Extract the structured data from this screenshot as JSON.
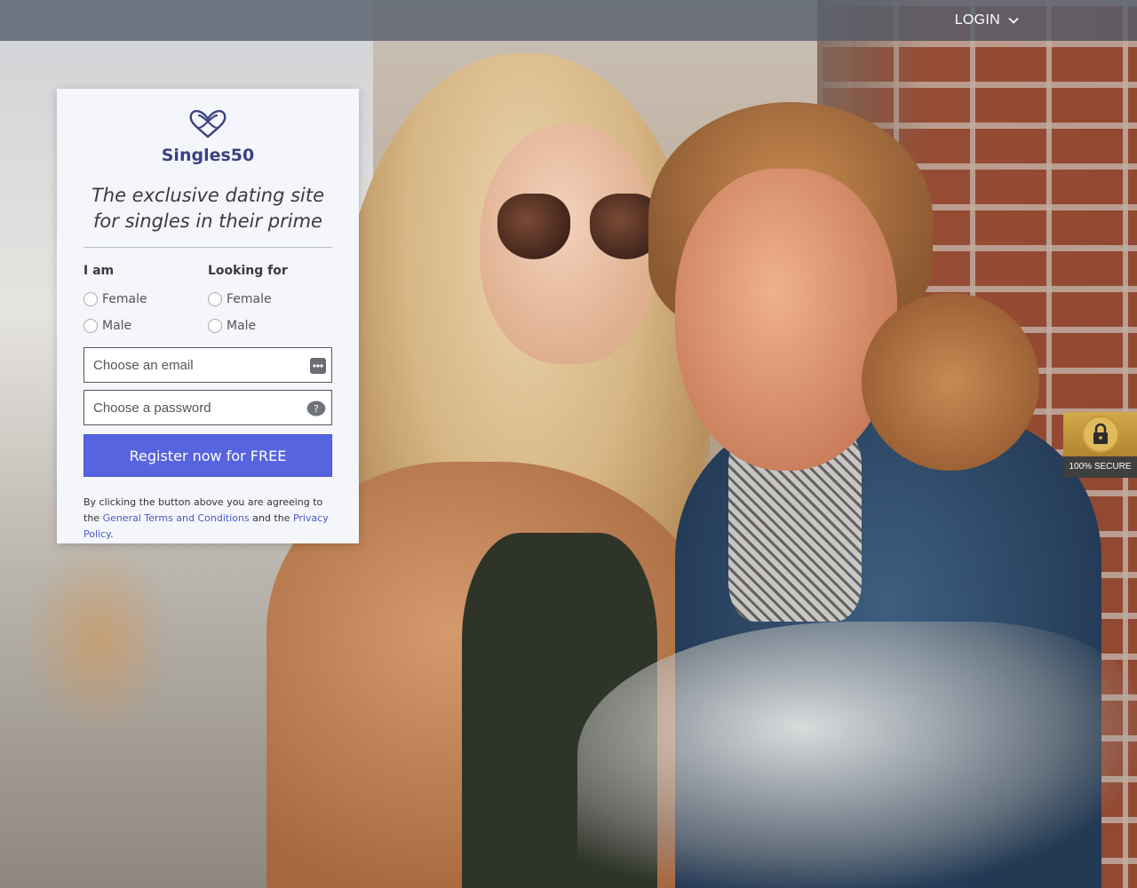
{
  "header": {
    "login_label": "LOGIN"
  },
  "brand": {
    "name": "Singles50",
    "color": "#3a4280"
  },
  "form": {
    "tagline": "The exclusive dating site for singles in their prime",
    "i_am": {
      "label": "I am",
      "options": [
        "Female",
        "Male"
      ]
    },
    "looking_for": {
      "label": "Looking for",
      "options": [
        "Female",
        "Male"
      ]
    },
    "email": {
      "placeholder": "Choose an email",
      "value": ""
    },
    "password": {
      "placeholder": "Choose a password",
      "value": ""
    },
    "register_label": "Register now for FREE",
    "register_color": "#5764e0",
    "legal": {
      "prefix": "By clicking the button above you are agreeing to the",
      "terms_link": "General Terms and Conditions",
      "middle": "and the",
      "privacy_link": "Privacy Policy",
      "suffix": "."
    }
  },
  "badge": {
    "text": "100% SECURE",
    "icon": "lock-icon"
  }
}
